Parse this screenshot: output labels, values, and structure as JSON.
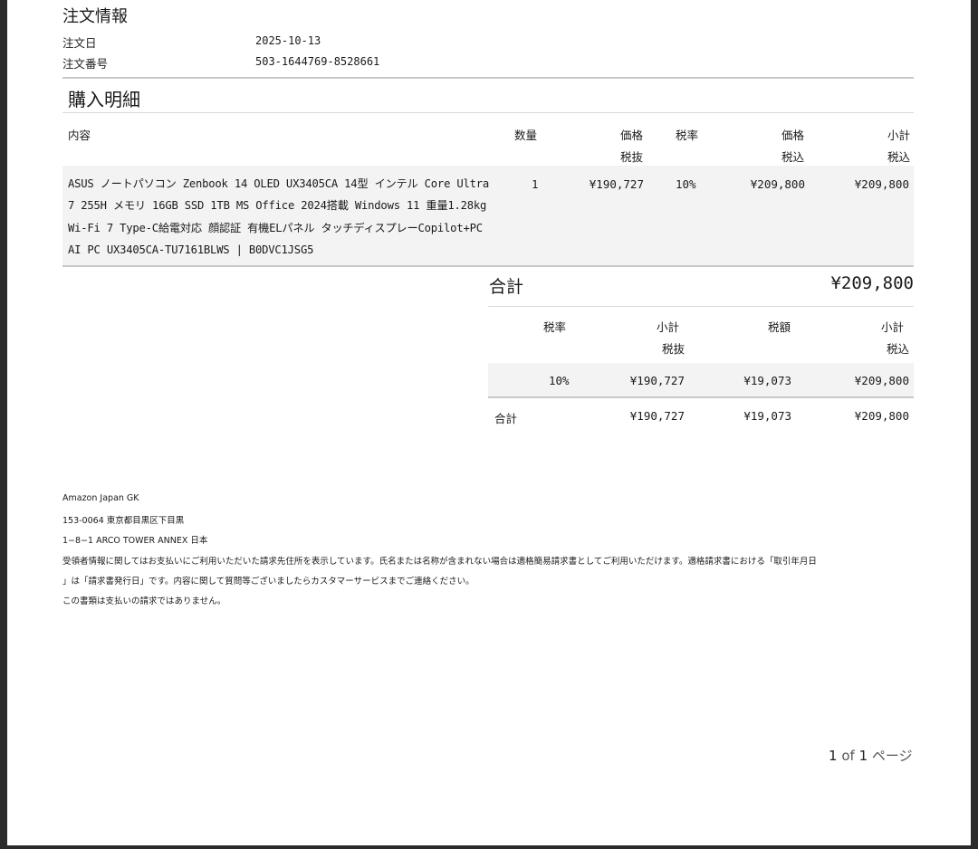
{
  "order_info": {
    "heading": "注文情報",
    "order_date_label": "注文日",
    "order_date": "2025-10-13",
    "order_number_label": "注文番号",
    "order_number": "503-1644769-8528661"
  },
  "purchase_details": {
    "heading": "購入明細",
    "columns": {
      "content": "内容",
      "qty": "数量",
      "price_top": "価格",
      "price_bottom": "税抜",
      "tax_rate": "税率",
      "price_incl_top": "価格",
      "price_incl_bottom": "税込",
      "subtotal_top": "小計",
      "subtotal_bottom": "税込"
    },
    "items": [
      {
        "description": "ASUS ノートパソコン Zenbook 14 OLED UX3405CA 14型 インテル Core Ultra 7 255H メモリ 16GB SSD 1TB MS Office 2024搭載 Windows 11 重量1.28kg Wi-Fi 7 Type-C給電対応 顔認証 有機ELパネル タッチディスプレーCopilot+PC AI PC UX3405CA-TU7161BLWS | B0DVC1JSG5",
        "qty": "1",
        "price_excl": "¥190,727",
        "tax_rate": "10%",
        "price_incl": "¥209,800",
        "subtotal_incl": "¥209,800"
      }
    ],
    "total_label": "合計",
    "total_value": "¥209,800"
  },
  "tax_summary": {
    "columns": {
      "tax_rate": "税率",
      "subtotal_top": "小計",
      "subtotal_bottom": "税抜",
      "tax_amount": "税額",
      "subtotal_incl_top": "小計",
      "subtotal_incl_bottom": "税込"
    },
    "rows": [
      {
        "tax_rate": "10%",
        "subtotal_excl": "¥190,727",
        "tax_amount": "¥19,073",
        "subtotal_incl": "¥209,800"
      }
    ],
    "total": {
      "label": "合計",
      "subtotal_excl": "¥190,727",
      "tax_amount": "¥19,073",
      "subtotal_incl": "¥209,800"
    }
  },
  "footer": {
    "company": "Amazon Japan GK",
    "address1": "153-0064 東京都目黒区下目黒",
    "address2": "1−8−1 ARCO TOWER ANNEX 日本",
    "note1": "受領者情報に関してはお支払いにご利用いただいた請求先住所を表示しています。氏名または名称が含まれない場合は適格簡易請求書としてご利用いただけます。適格請求書における「取引年月日",
    "note2": "」は「請求書発行日」です。内容に関して質問等ございましたらカスタマーサービスまでご連絡ください。",
    "note3": "この書類は支払いの請求ではありません。"
  },
  "pager": {
    "current": "1",
    "of": "of",
    "total": "1",
    "suffix": "ページ"
  }
}
